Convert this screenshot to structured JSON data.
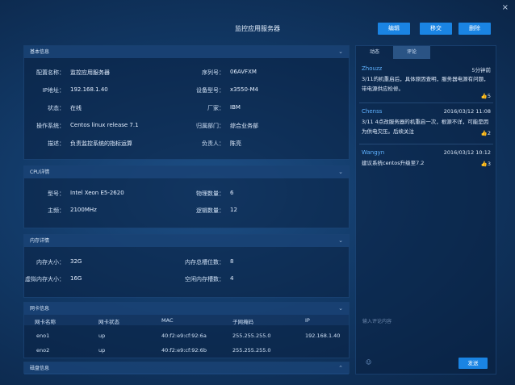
{
  "window": {
    "title": "监控应用服务器",
    "buttons": {
      "edit": "编辑",
      "transfer": "移交",
      "delete": "删除"
    },
    "close_glyph": "×"
  },
  "basic": {
    "header": "基本信息",
    "rows": [
      {
        "label": "配置名称：",
        "value": "监控应用服务器"
      },
      {
        "label": "IP地址：",
        "value": "192.168.1.40"
      },
      {
        "label": "状态：",
        "value": "在线"
      },
      {
        "label": "操作系统：",
        "value": "Centos linux release 7.1"
      },
      {
        "label": "描述：",
        "value": "负责监控系统的指标运算"
      }
    ],
    "rows_right": [
      {
        "label": "序列号：",
        "value": "06AVFXM"
      },
      {
        "label": "设备型号：",
        "value": "x3550-M4"
      },
      {
        "label": "厂家：",
        "value": "IBM"
      },
      {
        "label": "归属部门：",
        "value": "综合业务部"
      },
      {
        "label": "负责人：",
        "value": "陈亮"
      }
    ]
  },
  "cpu": {
    "header": "CPU详情",
    "rows": [
      {
        "label": "型号：",
        "value": "Intel Xeon E5-2620"
      },
      {
        "label": "主频：",
        "value": "2100MHz"
      }
    ],
    "rows_right": [
      {
        "label": "物理数量：",
        "value": "6"
      },
      {
        "label": "逻辑数量：",
        "value": "12"
      }
    ]
  },
  "memory": {
    "header": "内存详情",
    "rows": [
      {
        "label": "内存大小：",
        "value": "32G"
      },
      {
        "label": "虚拟内存大小：",
        "value": "16G"
      }
    ],
    "rows_right": [
      {
        "label": "内存总槽位数：",
        "value": "8"
      },
      {
        "label": "空闲内存槽数：",
        "value": "4"
      }
    ]
  },
  "nic": {
    "header": "网卡信息",
    "columns": [
      "网卡名称",
      "网卡状态",
      "MAC",
      "子网掩码",
      "IP"
    ],
    "rows": [
      [
        "eno1",
        "up",
        "40:f2:e9:cf:92:6a",
        "255.255.255.0",
        "192.168.1.40"
      ],
      [
        "eno2",
        "up",
        "40:f2:e9:cf:92:6b",
        "255.255.255.0",
        ""
      ]
    ]
  },
  "disk": {
    "header": "磁盘信息"
  },
  "sidebar": {
    "tabs": [
      "动态",
      "评论"
    ],
    "comments": [
      {
        "name": "Zhouzz",
        "time": "5分钟前",
        "text": "3/11的机重启后，具体原因查明，服务器电源有问题，带电源供应检修。",
        "likes": "5"
      },
      {
        "name": "Chenss",
        "time": "2016/03/12  11:08",
        "text": "3/11 4点改服务器的机重启一次，根源不详，可能是因为供电欠压。后续关注",
        "likes": "2"
      },
      {
        "name": "Wangyn",
        "time": "2016/03/12  10:12",
        "text": "建议系统centos升级至7.2",
        "likes": "3"
      }
    ],
    "reply_placeholder": "输入评论内容",
    "send_label": "发送"
  },
  "colors": {
    "accent": "#1a84e3",
    "link": "#5fb2ff",
    "thumb": "#e9c03a"
  }
}
